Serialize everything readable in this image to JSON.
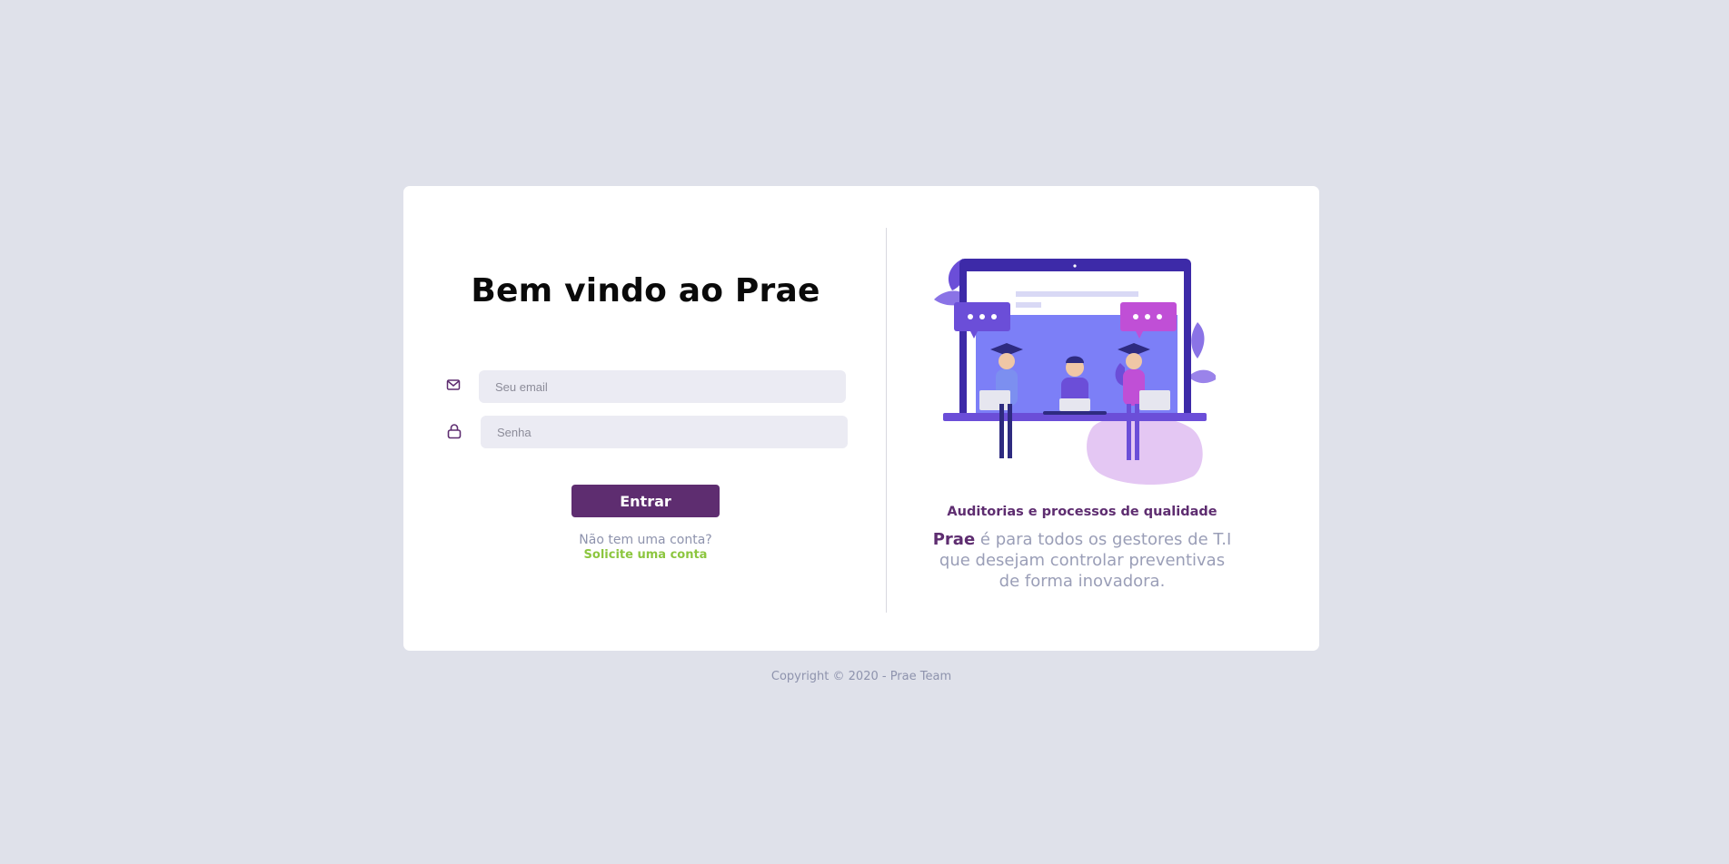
{
  "login": {
    "title": "Bem vindo ao Prae",
    "email_placeholder": "Seu email",
    "password_placeholder": "Senha",
    "submit_label": "Entrar",
    "signup_question": "Não tem uma conta?",
    "signup_link": "Solicite uma conta"
  },
  "promo": {
    "tagline": "Auditorias e processos de qualidade",
    "brand": "Prae",
    "description_line1": " é para todos os gestores de T.I",
    "description_line2": "que desejam controlar preventivas",
    "description_line3": "de forma inovadora."
  },
  "footer": {
    "copyright": "Copyright © 2020 - Prae Team"
  },
  "icons": {
    "email": "mail-icon",
    "password": "lock-icon"
  },
  "colors": {
    "background": "#dfe1ea",
    "brand_purple": "#5e2d70",
    "accent_green": "#8cc63f",
    "muted_text": "#8e93ad",
    "input_bg": "#ebebf3"
  }
}
